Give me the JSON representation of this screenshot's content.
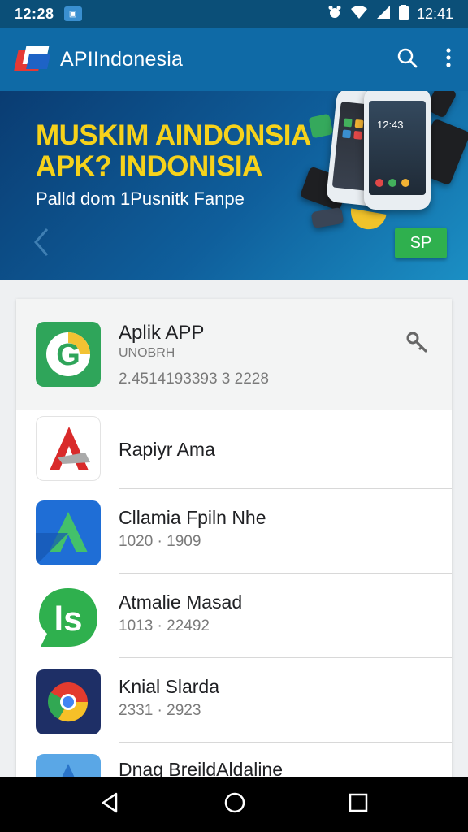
{
  "status_bar": {
    "time_left": "12:28",
    "time_right": "12:41"
  },
  "app_bar": {
    "title": "APIIndonesia"
  },
  "banner": {
    "headline_1": "MUSKIM AINDONSIA",
    "headline_2": "APK? INDONISIA",
    "subtitle": "Palld dom 1Pusnitk Fanpe",
    "button_label": "SP",
    "phone_screen_time": "12:43"
  },
  "featured_app": {
    "name": "Aplik APP",
    "subtitle": "UNOBRH",
    "meta": "2.4514193393 3 2228"
  },
  "apps": [
    {
      "name": "Rapiyr Ama",
      "meta": ""
    },
    {
      "name": "Cllamia Fpiln Nhe",
      "meta": "1020 · 1909"
    },
    {
      "name": "Atmalie Masad",
      "meta": "1013 · 22492"
    },
    {
      "name": "Knial Slarda",
      "meta": "2331 · 2923"
    },
    {
      "name": "Dnag BreildAldaline",
      "meta": ""
    }
  ],
  "colors": {
    "status_bar": "#0b4f78",
    "app_bar": "#0f6aa6",
    "banner_headline": "#f6d21b",
    "banner_button": "#2fb04e"
  }
}
